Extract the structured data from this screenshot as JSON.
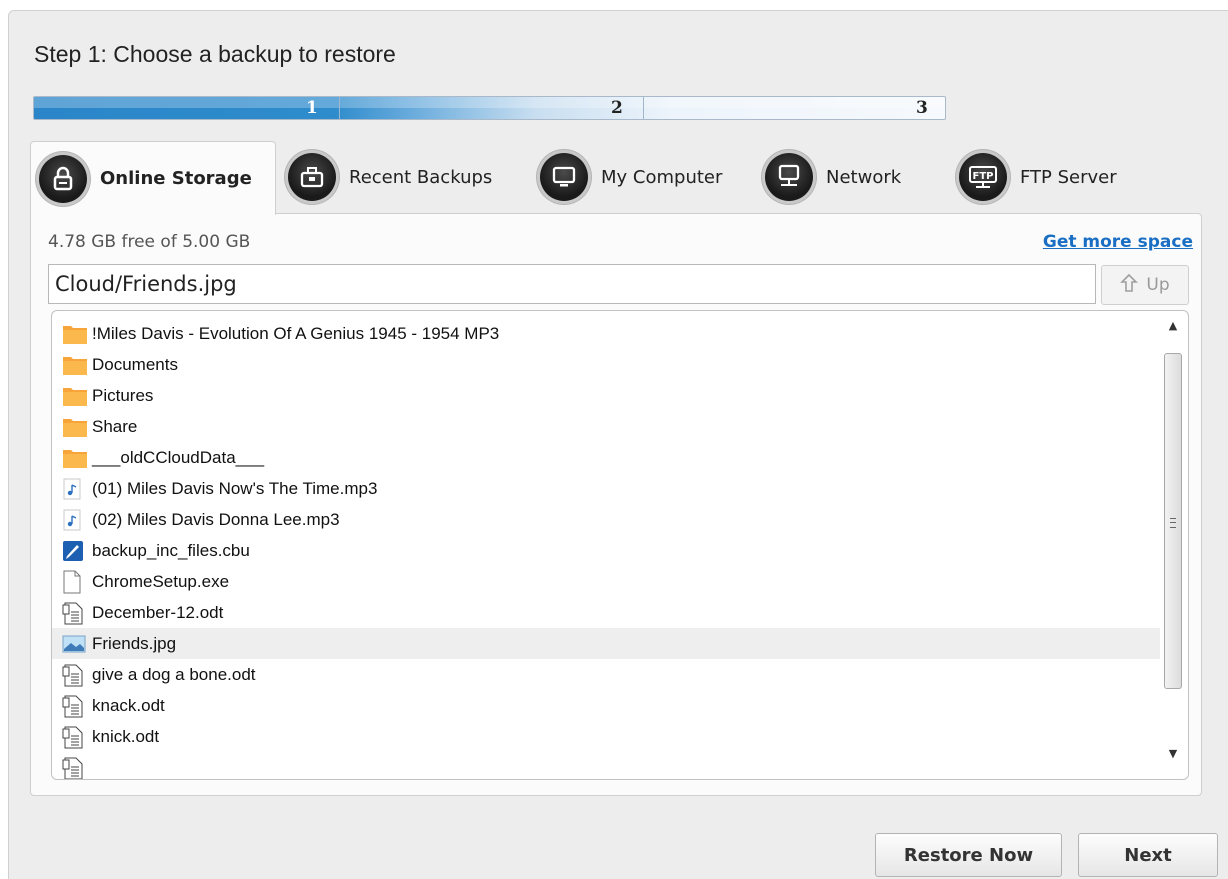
{
  "step_title": "Step 1: Choose a backup to restore",
  "progress": {
    "steps": [
      "1",
      "2",
      "3"
    ],
    "current_step": 1
  },
  "tabs": [
    {
      "label": "Online Storage",
      "icon": "lock-icon",
      "active": true
    },
    {
      "label": "Recent Backups",
      "icon": "briefcase-icon",
      "active": false
    },
    {
      "label": "My Computer",
      "icon": "monitor-icon",
      "active": false
    },
    {
      "label": "Network",
      "icon": "network-monitor-icon",
      "active": false
    },
    {
      "label": "FTP Server",
      "icon": "ftp-icon",
      "active": false
    }
  ],
  "storage": {
    "free_text": "4.78 GB free of 5.00 GB",
    "more_link": "Get more space"
  },
  "path": {
    "value": "Cloud/Friends.jpg",
    "up_label": "Up"
  },
  "files": [
    {
      "name": "!Miles Davis - Evolution Of A Genius 1945 - 1954 MP3",
      "type": "folder"
    },
    {
      "name": "Documents",
      "type": "folder"
    },
    {
      "name": "Pictures",
      "type": "folder"
    },
    {
      "name": "Share",
      "type": "folder"
    },
    {
      "name": "___oldCCloudData___",
      "type": "folder"
    },
    {
      "name": "(01) Miles Davis Now's The Time.mp3",
      "type": "audio"
    },
    {
      "name": "(02) Miles Davis Donna Lee.mp3",
      "type": "audio"
    },
    {
      "name": "backup_inc_files.cbu",
      "type": "backup"
    },
    {
      "name": "ChromeSetup.exe",
      "type": "file"
    },
    {
      "name": "December-12.odt",
      "type": "document"
    },
    {
      "name": "Friends.jpg",
      "type": "image",
      "selected": true
    },
    {
      "name": "give a dog a bone.odt",
      "type": "document"
    },
    {
      "name": "knack.odt",
      "type": "document"
    },
    {
      "name": "knick.odt",
      "type": "document"
    },
    {
      "name": "",
      "type": "document"
    }
  ],
  "buttons": {
    "restore": "Restore Now",
    "next": "Next"
  },
  "colors": {
    "accent": "#2a86c8",
    "link": "#1a6fc4",
    "folder": "#f7a43a",
    "selected_row": "#eeeeee"
  }
}
